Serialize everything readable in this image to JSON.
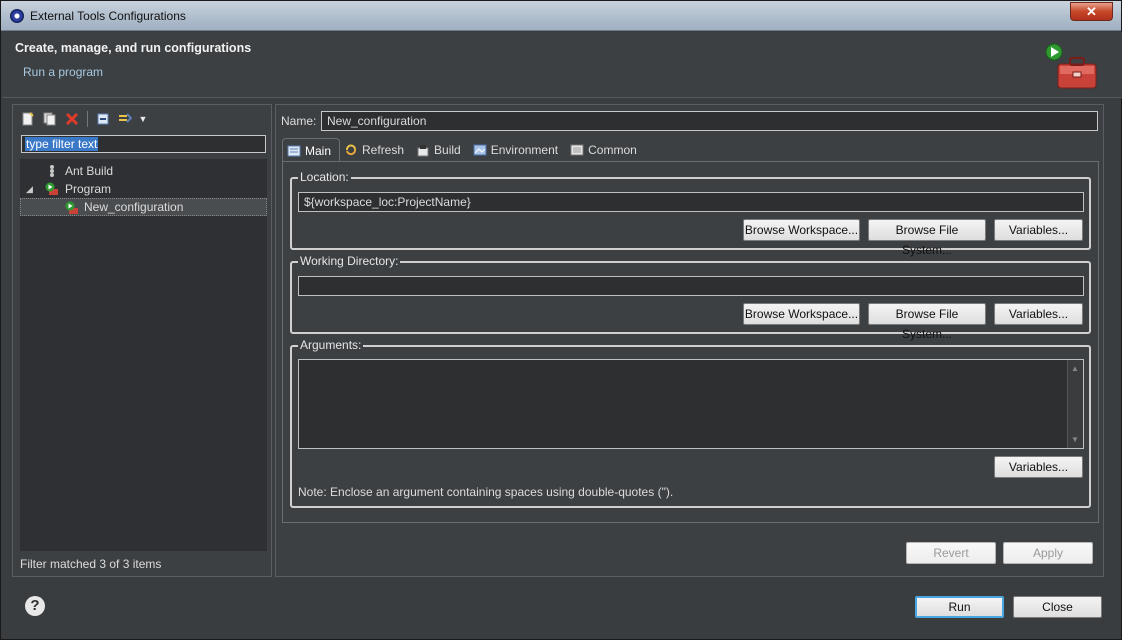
{
  "window": {
    "title": "External Tools Configurations",
    "close_symbol": "✕"
  },
  "header": {
    "title": "Create, manage, and run configurations",
    "subtitle": "Run a program"
  },
  "left": {
    "filter_placeholder": "type filter text",
    "tree": [
      {
        "label": "Ant Build"
      },
      {
        "label": "Program"
      },
      {
        "label": "New_configuration"
      }
    ],
    "status": "Filter matched 3 of 3 items"
  },
  "right": {
    "name_label": "Name:",
    "name_value": "New_configuration",
    "tabs": [
      {
        "label": "Main",
        "icon": "main-tab-icon"
      },
      {
        "label": "Refresh",
        "icon": "refresh-icon"
      },
      {
        "label": "Build",
        "icon": "build-icon"
      },
      {
        "label": "Environment",
        "icon": "environment-icon"
      },
      {
        "label": "Common",
        "icon": "common-icon"
      }
    ],
    "location": {
      "label": "Location:",
      "value": "${workspace_loc:ProjectName}",
      "buttons": [
        "Browse Workspace...",
        "Browse File System...",
        "Variables..."
      ]
    },
    "working_dir": {
      "label": "Working Directory:",
      "value": "",
      "buttons": [
        "Browse Workspace...",
        "Browse File System...",
        "Variables..."
      ]
    },
    "arguments": {
      "label": "Arguments:",
      "value": "",
      "variables_button": "Variables...",
      "note": "Note: Enclose an argument containing spaces using double-quotes (\")."
    },
    "revert": "Revert",
    "apply": "Apply"
  },
  "footer": {
    "run": "Run",
    "close": "Close",
    "help_symbol": "?"
  }
}
